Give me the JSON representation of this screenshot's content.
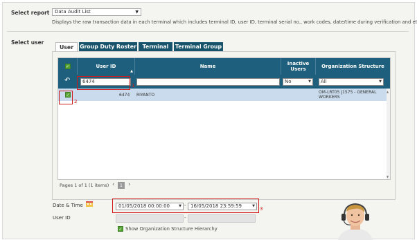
{
  "report": {
    "label": "Select report",
    "selected": "Data Audit List",
    "description": "Displays the raw transaction data in each terminal which includes terminal ID, user ID, terminal serial no., work codes, date/time during verification and etc."
  },
  "user_section": {
    "label": "Select user",
    "tabs": [
      {
        "label": "User",
        "active": true
      },
      {
        "label": "Group Duty Roster",
        "active": false
      },
      {
        "label": "Terminal",
        "active": false
      },
      {
        "label": "Terminal Group",
        "active": false
      }
    ]
  },
  "grid": {
    "columns": {
      "check": "✓",
      "user_id": "User ID",
      "name": "Name",
      "inactive_users": "Inactive Users",
      "org_structure": "Organization Structure"
    },
    "filter": {
      "reset_icon": "↶",
      "user_id_value": "6474",
      "name_value": "",
      "inactive_value": "No",
      "org_value": "All"
    },
    "rows": [
      {
        "user_id": "6474",
        "name": "RIYANTO",
        "org": "OM-LRT05 J1575 - GENERAL WORKERS",
        "checked": true
      }
    ],
    "pager": {
      "text": "Pages 1 of 1 (1 items)",
      "prev": "‹",
      "page": "1",
      "next": "›"
    }
  },
  "annotations": [
    "1",
    "2",
    "3"
  ],
  "datetime": {
    "label": "Date & Time",
    "from": "01/05/2018 00:00:00",
    "separator": "-",
    "to": "16/05/2018 23:59:59"
  },
  "user_id_field": {
    "label": "User ID",
    "separator": "-"
  },
  "hierarchy_option": {
    "label": "Show Organization Structure Hierarchy",
    "checked": true
  },
  "colors": {
    "header": "#1d5f7c",
    "tab_inactive": "#17536b",
    "selected_row": "#c9dbec",
    "checkbox": "#56a534",
    "annotation": "#d11a1a"
  }
}
